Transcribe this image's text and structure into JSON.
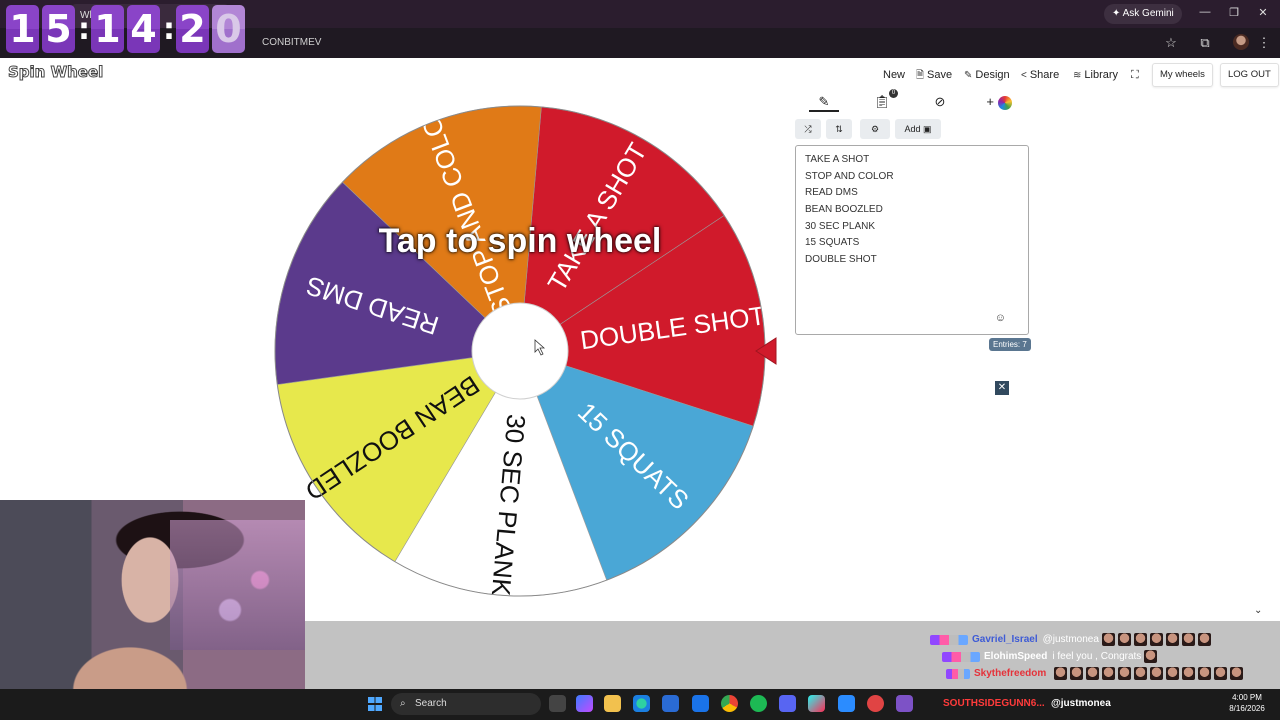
{
  "browser": {
    "tab_title": "Wheel",
    "url_fragment": "CONBITMEV",
    "ask_gemini": "Ask Gemini"
  },
  "clock": {
    "digits": [
      "1",
      "5",
      "1",
      "4",
      "2",
      "0"
    ],
    "separator": ":"
  },
  "app": {
    "logo": "Spin Wheel",
    "nav": {
      "new": "New",
      "save": "Save",
      "design": "Design",
      "share": "Share",
      "library": "Library",
      "my_wheels": "My wheels",
      "logout": "LOG OUT"
    }
  },
  "wheel": {
    "center_text": "Tap to spin wheel",
    "segments": [
      {
        "label": "TAKE A SHOT",
        "color": "#d01a2b"
      },
      {
        "label": "DOUBLE SHOT",
        "color": "#d01a2b"
      },
      {
        "label": "15 SQUATS",
        "color": "#4aa7d6"
      },
      {
        "label": "30 SEC PLANK",
        "color": "#ffffff"
      },
      {
        "label": "BEAN BOOZLED",
        "color": "#e7e84c"
      },
      {
        "label": "READ DMS",
        "color": "#5b3a8c"
      },
      {
        "label": "STOP AND COLOR",
        "color": "#e07a17"
      }
    ],
    "pointer_color": "#d01a2b"
  },
  "editor": {
    "badge_count": "0",
    "add_image_label": "Add",
    "entries": [
      "TAKE A SHOT",
      "STOP AND COLOR",
      "READ DMS",
      "BEAN BOOZLED",
      "30 SEC PLANK",
      "15 SQUATS",
      "DOUBLE SHOT"
    ],
    "entries_count_label": "Entries: 7"
  },
  "chat": {
    "messages": [
      {
        "user": "Gavriel_Israel",
        "user_color": "#3e5bd6",
        "text": "@justmonea"
      },
      {
        "user": "ElohimSpeed",
        "user_color": "#ffffff",
        "text": "i feel you , Congrats"
      },
      {
        "user": "Skythefreedom",
        "user_color": "#e5323a",
        "text": ""
      }
    ]
  },
  "taskbar": {
    "search_placeholder": "Search",
    "tray_text": "SOUTHSIDEGUNN6...",
    "tray_user": "@justmonea",
    "time": "4:00 PM",
    "date": "8/16/2026"
  }
}
